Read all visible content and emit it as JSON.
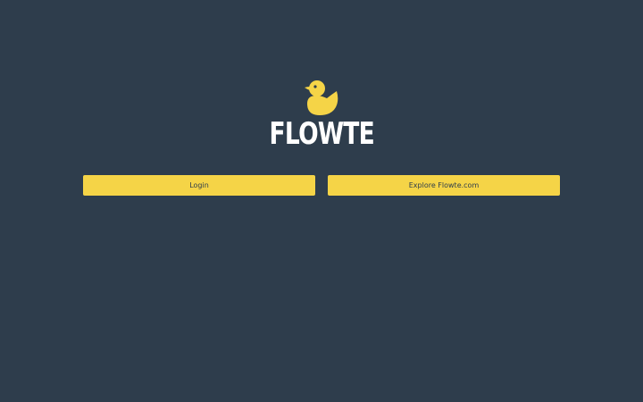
{
  "brand": {
    "name": "FLOWTE",
    "icon": "duck-icon",
    "icon_color": "#f5d447"
  },
  "actions": {
    "login_label": "Login",
    "explore_label": "Explore Flowte.com"
  },
  "colors": {
    "background": "#2e3d4c",
    "accent": "#f5d447",
    "text_light": "#ffffff"
  }
}
